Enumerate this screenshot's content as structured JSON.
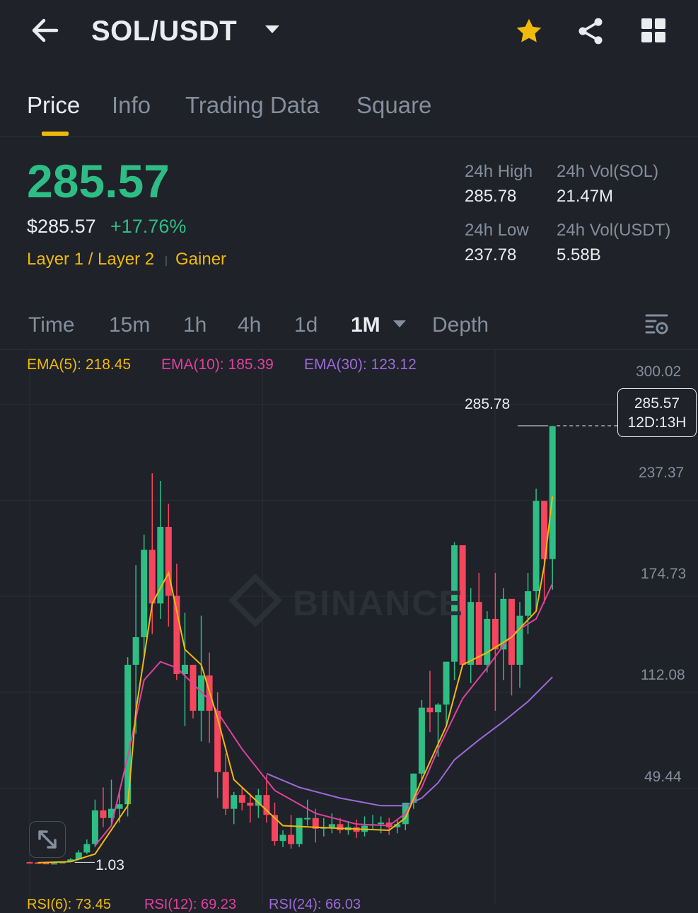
{
  "header": {
    "pair": "SOL/USDT",
    "back_icon": "arrow-left-icon",
    "dropdown_icon": "caret-down-icon",
    "favorite_icon": "star-icon",
    "share_icon": "share-icon",
    "grid_icon": "grid-icon",
    "favorite_color": "#f0b90b"
  },
  "tabs": [
    {
      "label": "Price",
      "active": true
    },
    {
      "label": "Info",
      "active": false
    },
    {
      "label": "Trading Data",
      "active": false
    },
    {
      "label": "Square",
      "active": false
    }
  ],
  "ticker": {
    "last_price": "285.57",
    "usd_price": "$285.57",
    "change": "+17.76%",
    "tags": [
      "Layer 1 / Layer 2",
      "Gainer"
    ],
    "stats": {
      "high_label": "24h High",
      "high_value": "285.78",
      "low_label": "24h Low",
      "low_value": "237.78",
      "vol_base_label": "24h Vol(SOL)",
      "vol_base_value": "21.47M",
      "vol_quote_label": "24h Vol(USDT)",
      "vol_quote_value": "5.58B"
    },
    "up_color": "#2ebd85",
    "down_color": "#f6465d"
  },
  "intervals": [
    {
      "label": "Time",
      "active": false
    },
    {
      "label": "15m",
      "active": false
    },
    {
      "label": "1h",
      "active": false
    },
    {
      "label": "4h",
      "active": false
    },
    {
      "label": "1d",
      "active": false
    },
    {
      "label": "1M",
      "active": true
    },
    {
      "label": "Depth",
      "active": false
    }
  ],
  "chart_settings_icon": "chart-settings-icon",
  "indicators": {
    "ema5": "EMA(5): 218.45",
    "ema10": "EMA(10): 185.39",
    "ema30": "EMA(30): 123.12",
    "ema5_color": "#f0b90b",
    "ema10_color": "#e040a0",
    "ema30_color": "#9c6ad8"
  },
  "y_axis": [
    "300.02",
    "237.37",
    "174.73",
    "112.08",
    "49.44"
  ],
  "high_marker": "285.78",
  "low_marker": "1.03",
  "current_price_box": {
    "price": "285.57",
    "countdown": "12D:13H"
  },
  "watermark": "BINANCE",
  "expand_icon": "expand-icon",
  "rsi": {
    "r6": "RSI(6): 73.45",
    "r12": "RSI(12): 69.23",
    "r24": "RSI(24): 66.03"
  },
  "chart_data": {
    "type": "candlestick",
    "interval": "1M",
    "y_ticks": [
      300.02,
      237.37,
      174.73,
      112.08,
      49.44
    ],
    "ylim": [
      1.03,
      300.02
    ],
    "candles": [
      [
        1.2,
        1.5,
        0.8,
        1.0
      ],
      [
        1.0,
        1.1,
        0.6,
        0.7
      ],
      [
        0.7,
        0.9,
        0.4,
        0.5
      ],
      [
        0.5,
        0.8,
        0.3,
        0.6
      ],
      [
        0.6,
        1.5,
        0.5,
        1.3
      ],
      [
        1.3,
        3.8,
        1.03,
        3.0
      ],
      [
        3.0,
        9.0,
        2.5,
        7.5
      ],
      [
        7.5,
        16,
        6.5,
        13
      ],
      [
        13,
        42,
        11,
        35
      ],
      [
        35,
        50,
        24,
        30
      ],
      [
        30,
        55,
        25,
        36
      ],
      [
        36,
        48,
        27,
        39
      ],
      [
        39,
        135,
        31,
        130
      ],
      [
        130,
        195,
        85,
        148
      ],
      [
        148,
        215,
        135,
        205
      ],
      [
        205,
        255,
        150,
        170
      ],
      [
        170,
        250,
        160,
        220
      ],
      [
        220,
        235,
        155,
        175
      ],
      [
        175,
        196,
        120,
        124
      ],
      [
        124,
        164,
        90,
        130
      ],
      [
        130,
        126,
        95,
        100
      ],
      [
        100,
        162,
        80,
        123
      ],
      [
        123,
        138,
        79,
        100
      ],
      [
        100,
        112,
        43,
        60
      ],
      [
        60,
        72,
        32,
        36
      ],
      [
        36,
        47,
        26,
        45
      ],
      [
        45,
        50,
        35,
        40
      ],
      [
        40,
        46,
        27,
        38
      ],
      [
        38,
        49,
        30,
        45
      ],
      [
        45,
        58,
        27,
        32
      ],
      [
        32,
        40,
        12,
        15
      ],
      [
        15,
        22,
        11,
        19
      ],
      [
        19,
        32,
        10,
        13
      ],
      [
        13,
        30,
        11,
        30
      ],
      [
        30,
        42,
        25,
        30
      ],
      [
        30,
        36,
        14,
        23
      ],
      [
        23,
        30,
        18,
        24
      ],
      [
        24,
        33,
        20,
        26
      ],
      [
        26,
        30,
        20,
        22
      ],
      [
        22,
        28,
        19,
        24
      ],
      [
        24,
        29,
        17,
        21
      ],
      [
        21,
        31,
        18,
        25
      ],
      [
        25,
        32,
        22,
        26
      ],
      [
        26,
        31,
        20,
        27
      ],
      [
        27,
        30,
        19,
        24
      ],
      [
        24,
        29,
        20,
        26
      ],
      [
        26,
        40,
        22,
        40
      ],
      [
        40,
        59,
        36,
        59
      ],
      [
        59,
        107,
        54,
        102
      ],
      [
        102,
        126,
        86,
        99
      ],
      [
        99,
        105,
        70,
        104
      ],
      [
        104,
        128,
        90,
        132
      ],
      [
        132,
        210,
        120,
        208
      ],
      [
        208,
        202,
        135,
        130
      ],
      [
        130,
        180,
        118,
        171
      ],
      [
        171,
        190,
        130,
        130
      ],
      [
        130,
        165,
        125,
        160
      ],
      [
        160,
        190,
        100,
        140
      ],
      [
        140,
        180,
        120,
        173
      ],
      [
        173,
        168,
        110,
        130
      ],
      [
        130,
        171,
        115,
        162
      ],
      [
        162,
        190,
        150,
        178
      ],
      [
        178,
        245,
        165,
        237
      ],
      [
        237,
        232,
        170,
        199
      ],
      [
        199,
        286,
        179,
        285.78
      ]
    ],
    "ema5": [
      [
        1.0,
        0.8
      ],
      [
        5,
        1.5
      ],
      [
        8,
        6.5
      ],
      [
        12,
        38
      ],
      [
        13,
        100
      ],
      [
        15,
        170
      ],
      [
        17,
        190
      ],
      [
        19,
        140
      ],
      [
        21,
        130
      ],
      [
        23,
        95
      ],
      [
        25,
        55
      ],
      [
        28,
        40
      ],
      [
        31,
        25
      ],
      [
        35,
        24
      ],
      [
        39,
        23
      ],
      [
        44,
        22
      ],
      [
        46,
        30
      ],
      [
        48,
        55
      ],
      [
        51,
        90
      ],
      [
        53,
        130
      ],
      [
        56,
        138
      ],
      [
        59,
        148
      ],
      [
        62,
        165
      ],
      [
        63,
        195
      ],
      [
        64,
        240
      ]
    ],
    "ema10": [
      [
        8,
        12
      ],
      [
        10,
        25
      ],
      [
        12,
        70
      ],
      [
        14,
        120
      ],
      [
        16,
        132
      ],
      [
        18,
        128
      ],
      [
        22,
        107
      ],
      [
        26,
        75
      ],
      [
        30,
        48
      ],
      [
        35,
        33
      ],
      [
        40,
        26
      ],
      [
        44,
        25
      ],
      [
        46,
        33
      ],
      [
        48,
        50
      ],
      [
        50,
        75
      ],
      [
        53,
        108
      ],
      [
        56,
        128
      ],
      [
        59,
        150
      ],
      [
        62,
        160
      ],
      [
        64,
        183
      ]
    ],
    "ema30": [
      [
        29,
        59
      ],
      [
        33,
        50
      ],
      [
        38,
        43
      ],
      [
        43,
        38
      ],
      [
        46,
        38
      ],
      [
        48,
        43
      ],
      [
        50,
        53
      ],
      [
        52,
        68
      ],
      [
        55,
        81
      ],
      [
        58,
        93
      ],
      [
        61,
        106
      ],
      [
        64,
        122
      ]
    ]
  }
}
